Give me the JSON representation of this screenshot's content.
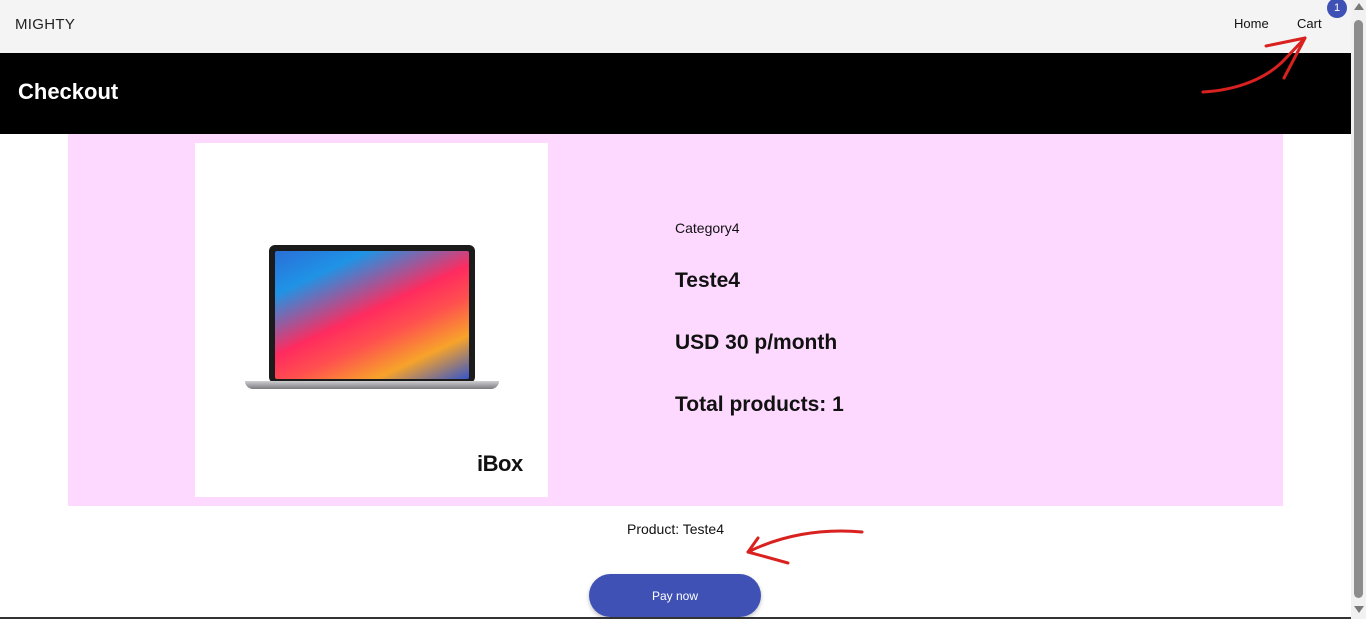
{
  "header": {
    "brand": "MIGHTY",
    "nav": {
      "home": "Home",
      "cart": "Cart",
      "cart_count": "1"
    }
  },
  "page": {
    "title": "Checkout"
  },
  "product": {
    "image_brand": "iBox",
    "category": "Category4",
    "name": "Teste4",
    "price": "USD 30 p/month",
    "total": "Total products: 1",
    "summary": "Product: Teste4"
  },
  "actions": {
    "pay_label": "Pay now"
  },
  "colors": {
    "accent": "#3f51b5",
    "card_background": "#fdd9ff",
    "header_band": "#000000",
    "annotation": "#d9211f"
  }
}
